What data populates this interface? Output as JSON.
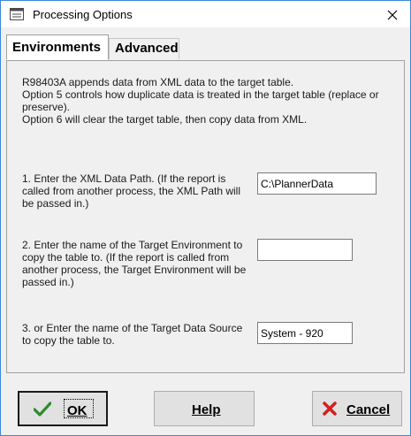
{
  "window": {
    "title": "Processing Options",
    "app_icon": "processing-options-icon",
    "close_icon": "close-icon"
  },
  "tabs": [
    {
      "label": "Environments",
      "active": true
    },
    {
      "label": "Advanced",
      "active": false
    }
  ],
  "description": {
    "line1": "R98403A appends data from XML data to the target table.",
    "line2": "Option 5 controls how duplicate data is treated in the target table (replace or preserve).",
    "line3": "Option 6 will clear the target table, then copy data from XML."
  },
  "options": [
    {
      "label": "1. Enter the XML Data Path. (If the report is called from another process, the XML Path will be passed in.)",
      "value": "C:\\PlannerData"
    },
    {
      "label": "2. Enter the name of the Target Environment to copy the table to. (If the report is called from another process, the Target Environment will be passed in.)",
      "value": ""
    },
    {
      "label": "3. or Enter the name of the Target Data Source to copy the table to.",
      "value": "System - 920"
    }
  ],
  "buttons": {
    "ok": {
      "label": "OK",
      "icon": "checkmark-icon"
    },
    "help": {
      "label": "Help"
    },
    "cancel": {
      "label": "Cancel",
      "icon": "red-x-icon"
    }
  },
  "colors": {
    "window_border": "#3a8ad6",
    "ok_check": "#2e8b2e",
    "cancel_x": "#d42020"
  }
}
